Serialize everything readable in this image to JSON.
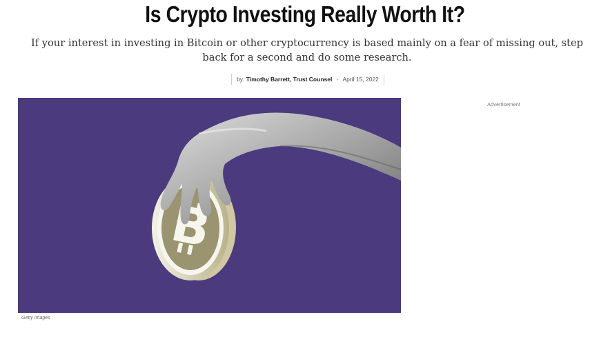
{
  "article": {
    "title": "Is Crypto Investing Really Worth It?",
    "dek": "If your interest in investing in Bitcoin or other cryptocurrency is based mainly on a fear of missing out, step back for a second and do some research.",
    "byline_prefix": "by:",
    "author": "Timothy Barrett, Trust Counsel",
    "separator": "-",
    "date": "April 15, 2022"
  },
  "hero": {
    "credit": "Getty Images",
    "background_color": "#4b3a7e",
    "coin_color": "#9a9470",
    "icon": "bitcoin-icon"
  },
  "sidebar": {
    "ad_label": "Advertisement"
  }
}
